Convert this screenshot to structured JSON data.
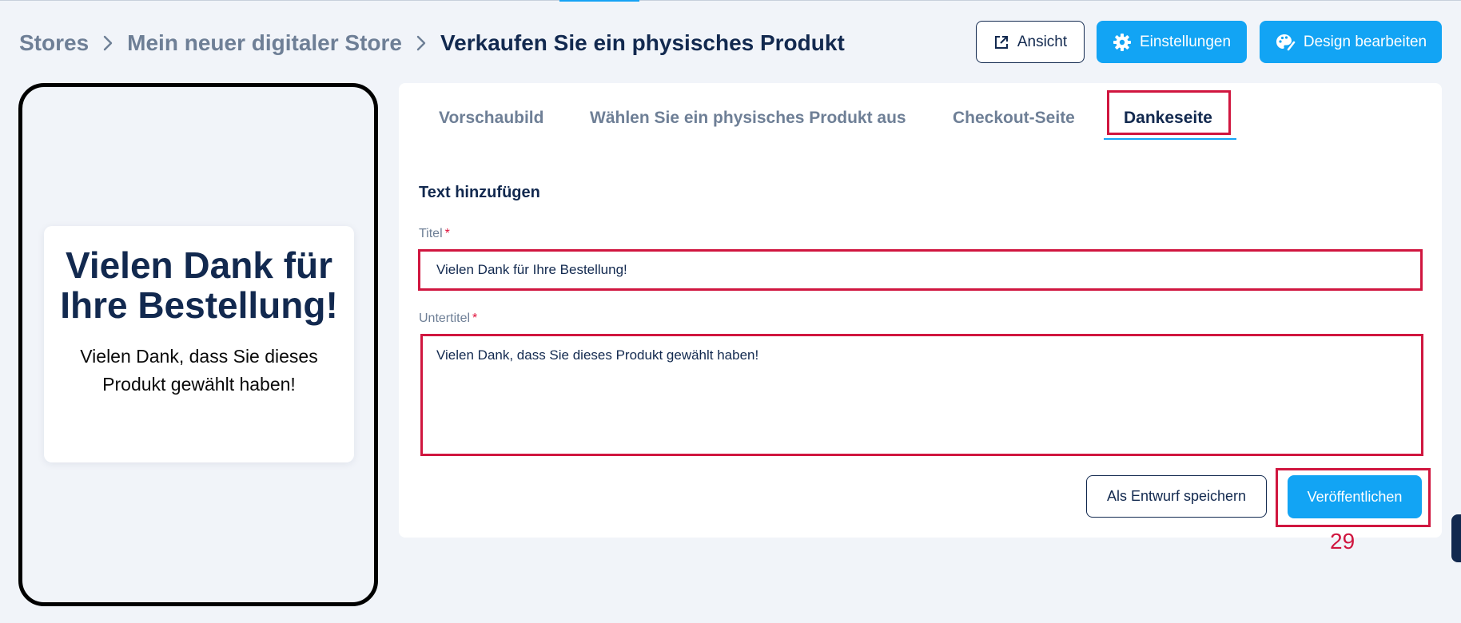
{
  "breadcrumb": {
    "stores": "Stores",
    "store": "Mein neuer digitaler Store",
    "current": "Verkaufen Sie ein physisches Produkt"
  },
  "header": {
    "view_label": "Ansicht",
    "settings_label": "Einstellungen",
    "design_label": "Design bearbeiten"
  },
  "preview": {
    "title": "Vielen Dank für Ihre Bestellung!",
    "subtitle": "Vielen Dank, dass Sie dieses Produkt gewählt haben!"
  },
  "tabs": [
    {
      "label": "Vorschaubild"
    },
    {
      "label": "Wählen Sie ein physisches Produkt aus"
    },
    {
      "label": "Checkout-Seite"
    },
    {
      "label": "Dankeseite"
    }
  ],
  "form": {
    "section_title": "Text hinzufügen",
    "title_label": "Titel",
    "title_value": "Vielen Dank für Ihre Bestellung!",
    "subtitle_label": "Untertitel",
    "subtitle_value": "Vielen Dank, dass Sie dieses Produkt gewählt haben!",
    "required_marker": "*"
  },
  "actions": {
    "draft_label": "Als Entwurf speichern",
    "publish_label": "Veröffentlichen"
  },
  "annotation": {
    "step_number": "29"
  },
  "colors": {
    "accent": "#12a4f4",
    "navy": "#12294f",
    "highlight": "#d0163f",
    "muted": "#6e7f96"
  }
}
